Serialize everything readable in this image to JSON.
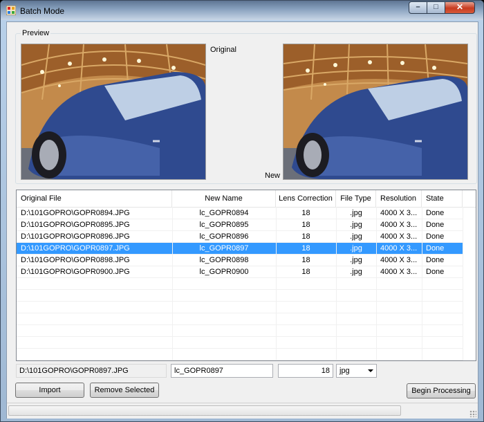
{
  "window": {
    "title": "Batch Mode",
    "controls": {
      "minimize": "–",
      "maximize": "□",
      "close": "✕"
    }
  },
  "preview": {
    "group_label": "Preview",
    "original_label": "Original",
    "new_label": "New"
  },
  "table": {
    "columns": [
      "Original File",
      "New Name",
      "Lens Correction",
      "File Type",
      "Resolution",
      "State"
    ],
    "rows": [
      [
        "D:\\101GOPRO\\GOPR0894.JPG",
        "lc_GOPR0894",
        "18",
        ".jpg",
        "4000 X 3...",
        "Done"
      ],
      [
        "D:\\101GOPRO\\GOPR0895.JPG",
        "lc_GOPR0895",
        "18",
        ".jpg",
        "4000 X 3...",
        "Done"
      ],
      [
        "D:\\101GOPRO\\GOPR0896.JPG",
        "lc_GOPR0896",
        "18",
        ".jpg",
        "4000 X 3...",
        "Done"
      ],
      [
        "D:\\101GOPRO\\GOPR0897.JPG",
        "lc_GOPR0897",
        "18",
        ".jpg",
        "4000 X 3...",
        "Done"
      ],
      [
        "D:\\101GOPRO\\GOPR0898.JPG",
        "lc_GOPR0898",
        "18",
        ".jpg",
        "4000 X 3...",
        "Done"
      ],
      [
        "D:\\101GOPRO\\GOPR0900.JPG",
        "lc_GOPR0900",
        "18",
        ".jpg",
        "4000 X 3...",
        "Done"
      ]
    ],
    "selected_row": 3
  },
  "editor": {
    "original_path": "D:\\101GOPRO\\GOPR0897.JPG",
    "new_name": "lc_GOPR0897",
    "lens_correction": "18",
    "file_type": "jpg"
  },
  "buttons": {
    "import": "Import",
    "remove_selected": "Remove Selected",
    "begin_processing": "Begin Processing"
  },
  "progress": {
    "value_percent": 0
  },
  "colors": {
    "selection": "#3399ff",
    "car_blue": "#2f4a8f"
  }
}
